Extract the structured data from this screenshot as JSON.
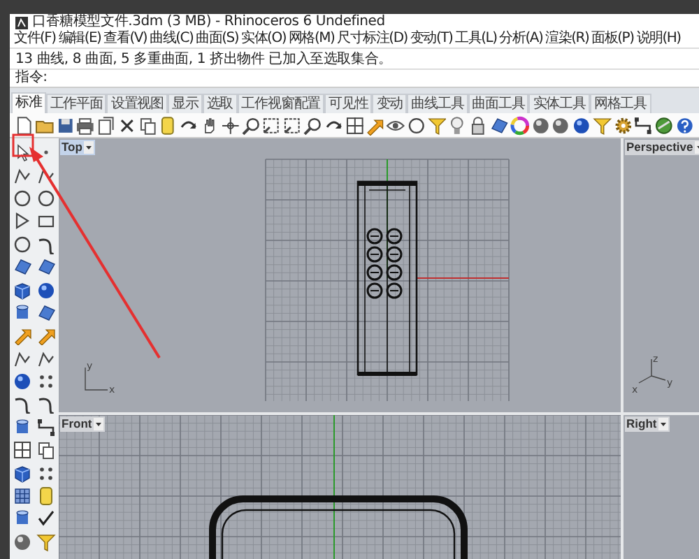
{
  "window": {
    "title": "口香糖模型文件.3dm (3 MB) - Rhinoceros 6 Undefined"
  },
  "menu": [
    "文件(F)",
    "编辑(E)",
    "查看(V)",
    "曲线(C)",
    "曲面(S)",
    "实体(O)",
    "网格(M)",
    "尺寸标注(D)",
    "变动(T)",
    "工具(L)",
    "分析(A)",
    "渲染(R)",
    "面板(P)",
    "说明(H)"
  ],
  "command_history": [
    "13 曲线, 8 曲面, 5 多重曲面, 1 挤出物件 已加入至选取集合。"
  ],
  "command_prompt": "指令:",
  "tabs": [
    {
      "label": "标准",
      "selected": true
    },
    {
      "label": "工作平面",
      "selected": false
    },
    {
      "label": "设置视图",
      "selected": false
    },
    {
      "label": "显示",
      "selected": false
    },
    {
      "label": "选取",
      "selected": false
    },
    {
      "label": "工作视窗配置",
      "selected": false
    },
    {
      "label": "可见性",
      "selected": false
    },
    {
      "label": "变动",
      "selected": false
    },
    {
      "label": "曲线工具",
      "selected": false
    },
    {
      "label": "曲面工具",
      "selected": false
    },
    {
      "label": "实体工具",
      "selected": false
    },
    {
      "label": "网格工具",
      "selected": false
    }
  ],
  "viewports": [
    {
      "title": "Top",
      "active": true,
      "axis_labels": [
        "y",
        "x"
      ]
    },
    {
      "title": "Perspective",
      "active": false,
      "axis_labels": [
        "z",
        "x",
        "y"
      ]
    },
    {
      "title": "Front",
      "active": false
    },
    {
      "title": "Right",
      "active": false
    }
  ]
}
